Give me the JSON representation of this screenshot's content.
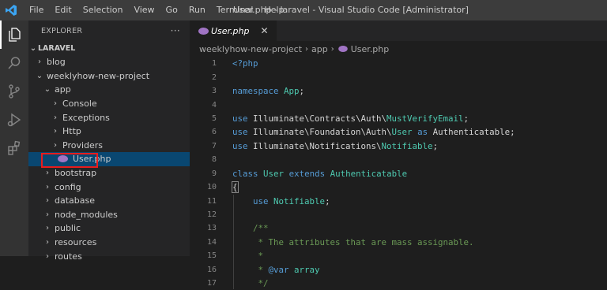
{
  "titlebar": {
    "menu": [
      "File",
      "Edit",
      "Selection",
      "View",
      "Go",
      "Run",
      "Terminal",
      "Help"
    ],
    "window_title": "User.php - laravel - Visual Studio Code [Administrator]"
  },
  "activity_bar": [
    "files-icon",
    "search-icon",
    "source-control-icon",
    "run-debug-icon",
    "extensions-icon"
  ],
  "sidebar": {
    "header": "EXPLORER",
    "more": "···",
    "section": "LARAVEL",
    "tree": [
      {
        "label": "blog",
        "depth": 1,
        "chevron": "›"
      },
      {
        "label": "weeklyhow-new-project",
        "depth": 1,
        "chevron": "⌄"
      },
      {
        "label": "app",
        "depth": 2,
        "chevron": "⌄"
      },
      {
        "label": "Console",
        "depth": 3,
        "chevron": "›"
      },
      {
        "label": "Exceptions",
        "depth": 3,
        "chevron": "›"
      },
      {
        "label": "Http",
        "depth": 3,
        "chevron": "›"
      },
      {
        "label": "Providers",
        "depth": 3,
        "chevron": "›"
      },
      {
        "label": "User.php",
        "depth": 3,
        "chevron": "",
        "file": true,
        "selected": true
      },
      {
        "label": "bootstrap",
        "depth": 2,
        "chevron": "›"
      },
      {
        "label": "config",
        "depth": 2,
        "chevron": "›"
      },
      {
        "label": "database",
        "depth": 2,
        "chevron": "›"
      },
      {
        "label": "node_modules",
        "depth": 2,
        "chevron": "›"
      },
      {
        "label": "public",
        "depth": 2,
        "chevron": "›"
      },
      {
        "label": "resources",
        "depth": 2,
        "chevron": "›"
      },
      {
        "label": "routes",
        "depth": 2,
        "chevron": "›"
      }
    ]
  },
  "editor": {
    "tab": {
      "label": "User.php",
      "close": "✕"
    },
    "breadcrumb": [
      "weeklyhow-new-project",
      "app",
      "User.php"
    ],
    "lines": [
      {
        "n": "1",
        "tokens": [
          [
            "kw",
            "<?php"
          ]
        ]
      },
      {
        "n": "2",
        "tokens": []
      },
      {
        "n": "3",
        "tokens": [
          [
            "kw",
            "namespace"
          ],
          [
            "pl",
            " "
          ],
          [
            "ty",
            "App"
          ],
          [
            "pl",
            ";"
          ]
        ]
      },
      {
        "n": "4",
        "tokens": []
      },
      {
        "n": "5",
        "tokens": [
          [
            "kw",
            "use"
          ],
          [
            "pl",
            " Illuminate\\Contracts\\Auth\\"
          ],
          [
            "ty",
            "MustVerifyEmail"
          ],
          [
            "pl",
            ";"
          ]
        ]
      },
      {
        "n": "6",
        "tokens": [
          [
            "kw",
            "use"
          ],
          [
            "pl",
            " Illuminate\\Foundation\\Auth\\"
          ],
          [
            "ty",
            "User"
          ],
          [
            "pl",
            " "
          ],
          [
            "kw",
            "as"
          ],
          [
            "pl",
            " Authenticatable;"
          ]
        ]
      },
      {
        "n": "7",
        "tokens": [
          [
            "kw",
            "use"
          ],
          [
            "pl",
            " Illuminate\\Notifications\\"
          ],
          [
            "ty",
            "Notifiable"
          ],
          [
            "pl",
            ";"
          ]
        ]
      },
      {
        "n": "8",
        "tokens": []
      },
      {
        "n": "9",
        "tokens": [
          [
            "kw",
            "class"
          ],
          [
            "pl",
            " "
          ],
          [
            "ty",
            "User"
          ],
          [
            "pl",
            " "
          ],
          [
            "kw",
            "extends"
          ],
          [
            "pl",
            " "
          ],
          [
            "ty",
            "Authenticatable"
          ]
        ]
      },
      {
        "n": "10",
        "tokens": [
          [
            "pl",
            "{"
          ]
        ]
      },
      {
        "n": "11",
        "tokens": [
          [
            "pl",
            "    "
          ],
          [
            "kw",
            "use"
          ],
          [
            "pl",
            " "
          ],
          [
            "ty",
            "Notifiable"
          ],
          [
            "pl",
            ";"
          ]
        ]
      },
      {
        "n": "12",
        "tokens": []
      },
      {
        "n": "13",
        "tokens": [
          [
            "cm",
            "    /**"
          ]
        ]
      },
      {
        "n": "14",
        "tokens": [
          [
            "cm",
            "     * The attributes that are mass assignable."
          ]
        ]
      },
      {
        "n": "15",
        "tokens": [
          [
            "cm",
            "     *"
          ]
        ]
      },
      {
        "n": "16",
        "tokens": [
          [
            "cm",
            "     * "
          ],
          [
            "kw",
            "@var"
          ],
          [
            "cm",
            " "
          ],
          [
            "ty",
            "array"
          ]
        ]
      },
      {
        "n": "17",
        "tokens": [
          [
            "cm",
            "     */"
          ]
        ]
      }
    ]
  },
  "colors": {
    "accent": "#007acc",
    "selection": "#094771",
    "highlight_box": "#e81c1c",
    "php_icon": "#a074c4"
  }
}
